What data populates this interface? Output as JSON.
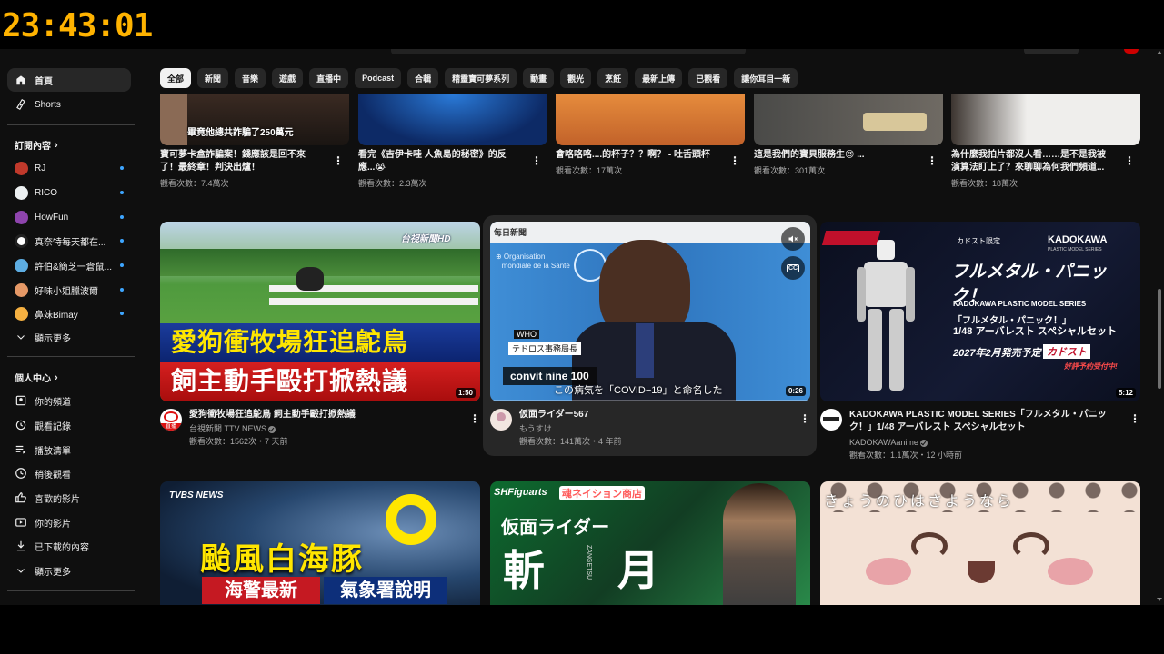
{
  "overlay": {
    "clock": "23:43:01"
  },
  "sidebar": {
    "nav": [
      {
        "label": "首頁",
        "icon": "home-icon",
        "active": true
      },
      {
        "label": "Shorts",
        "icon": "shorts-icon"
      }
    ],
    "subscriptions_title": "訂閱內容",
    "subscriptions": [
      {
        "label": "RJ",
        "color": "#c0392b"
      },
      {
        "label": "RICO",
        "color": "#ecf0f1"
      },
      {
        "label": "HowFun",
        "color": "#8e44ad"
      },
      {
        "label": "真奈特每天都在...",
        "color": "#ffffff"
      },
      {
        "label": "許伯&簡芝一倉鼠...",
        "color": "#5dade2"
      },
      {
        "label": "好味小姐臘波爾",
        "color": "#e59866"
      },
      {
        "label": "鼻妹Bimay",
        "color": "#f5b041"
      }
    ],
    "show_more": "顯示更多",
    "you_title": "個人中心",
    "you_items": [
      {
        "label": "你的頻道",
        "icon": "channel-icon"
      },
      {
        "label": "觀看記錄",
        "icon": "history-icon"
      },
      {
        "label": "播放清單",
        "icon": "playlist-icon"
      },
      {
        "label": "稍後觀看",
        "icon": "clock-icon"
      },
      {
        "label": "喜歡的影片",
        "icon": "like-icon"
      },
      {
        "label": "你的影片",
        "icon": "video-icon"
      },
      {
        "label": "已下載的內容",
        "icon": "download-icon"
      }
    ],
    "show_more_2": "顯示更多"
  },
  "chips": [
    "全部",
    "新聞",
    "音樂",
    "遊戲",
    "直播中",
    "Podcast",
    "合輯",
    "精靈寶可夢系列",
    "動畫",
    "觀光",
    "烹飪",
    "最新上傳",
    "已觀看",
    "讓你耳目一新"
  ],
  "row1": [
    {
      "title1": "寶可夢卡盒詐騙案！錢應該是回不來",
      "title2": "了！最終章！判決出爐！",
      "meta": "觀看次數：7.4萬次",
      "overlay_text": "畢竟他總共詐騙了250萬元"
    },
    {
      "title1": "看完《吉伊卡哇 人魚島的秘密》的反",
      "title2": "應...😭",
      "meta": "觀看次數：2.3萬次"
    },
    {
      "title1": "會咯咯咯....的杯子？？啊？ - 吐舌頭杯",
      "title2": "",
      "meta": "觀看次數：17萬次"
    },
    {
      "title1": "這是我們的寶貝服務生😍 ...",
      "title2": "",
      "meta": "觀看次數：301萬次"
    },
    {
      "title1": "為什麼我拍片都沒人看……是不是我被",
      "title2": "演算法盯上了？來聊聊為何我們頻道...",
      "meta": "觀看次數：18萬次"
    }
  ],
  "row2": [
    {
      "title": "愛狗衝牧場狂追鴕鳥  飼主動手毆打掀熱議",
      "channel": "台視新聞 TTV NEWS",
      "meta": "觀看次數：1562次・7 天前",
      "duration": "1:50",
      "thumb_line1": "愛狗衝牧場狂追鴕鳥",
      "thumb_line2": "飼主動手毆打掀熱議",
      "brand": "台視新聞HD",
      "avatar_badge": "直播"
    },
    {
      "title": "仮面ライダー567",
      "channel": "もうすけ",
      "meta": "觀看次數：141萬次・4 年前",
      "duration": "0:26",
      "who_tag": "WHO",
      "role_tag": "テドロス事務局長",
      "caption": "convit nine 100",
      "subtitle": "この病気を「COVID−19」と命名した",
      "cc": "CC",
      "logo": "每日新聞"
    },
    {
      "title1": "KADOKAWA PLASTIC MODEL SERIES「フルメタル・パニッ",
      "title2": "ク！」1/48 アーバレスト スペシャルセット",
      "channel": "KADOKAWAanime",
      "meta": "觀看次數：1.1萬次・12 小時前",
      "duration": "5:12",
      "brand": "KADOKAWA",
      "brand_sub": "PLASTIC MODEL SERIES",
      "corner_tag": "カドスト限定",
      "headline": "フルメタル・パニック！",
      "series": "KADOKAWA PLASTIC MODEL SERIES",
      "series_jp": "「フルメタル・パニック！」",
      "product": "1/48 アーバレスト スペシャルセット",
      "release": "2027年2月発売予定",
      "store": "カドスト",
      "preorder": "好評予約受付中!"
    }
  ],
  "row3": [
    {
      "brand": "TVBS NEWS",
      "line1": "颱風白海豚",
      "tag1": "海警最新",
      "tag2": "氣象署說明"
    },
    {
      "brand": "SHFiguarts",
      "store": "魂ネイション商店",
      "line1": "仮面ライダー",
      "line2": "斬 月",
      "sub": "ZANGETSU"
    },
    {
      "line1": "きょうのひはさようなら"
    }
  ]
}
